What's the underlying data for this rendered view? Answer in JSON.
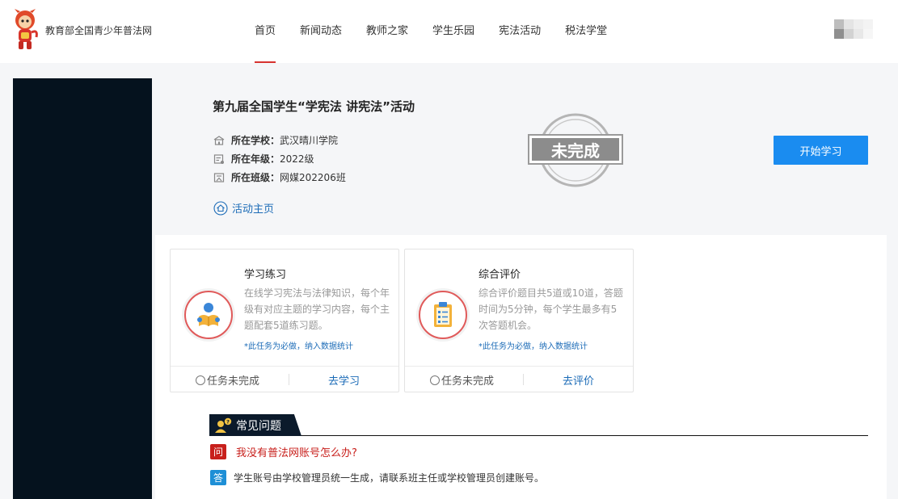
{
  "header": {
    "site_name": "教育部全国青少年普法网",
    "nav": [
      "首页",
      "新闻动态",
      "教师之家",
      "学生乐园",
      "宪法活动",
      "税法学堂"
    ]
  },
  "activity": {
    "title": "第九届全国学生“学宪法 讲宪法”活动",
    "school_label": "所在学校：",
    "school_value": "武汉晴川学院",
    "grade_label": "所在年级：",
    "grade_value": "2022级",
    "class_label": "所在班级：",
    "class_value": "网媒202206班",
    "home_link": "活动主页",
    "stamp": "未完成",
    "start_button": "开始学习"
  },
  "cards": [
    {
      "title": "学习练习",
      "desc": "在线学习宪法与法律知识，每个年级有对应主题的学习内容，每个主题配套5道练习题。",
      "note": "*此任务为必做，纳入数据统计",
      "status": "任务未完成",
      "action": "去学习"
    },
    {
      "title": "综合评价",
      "desc": "综合评价题目共5道或10道，答题时间为5分钟，每个学生最多有5次答题机会。",
      "note": "*此任务为必做，纳入数据统计",
      "status": "任务未完成",
      "action": "去评价"
    }
  ],
  "faq": {
    "title": "常见问题",
    "q_badge": "问",
    "a_badge": "答",
    "question": "我没有普法网账号怎么办?",
    "answer": "学生账号由学校管理员统一生成，请联系班主任或学校管理员创建账号。"
  },
  "colors": {
    "accent_red": "#d7332f",
    "primary_blue": "#1a8cf0",
    "link_blue": "#1b6bb7",
    "dark_panel": "#05121e"
  }
}
